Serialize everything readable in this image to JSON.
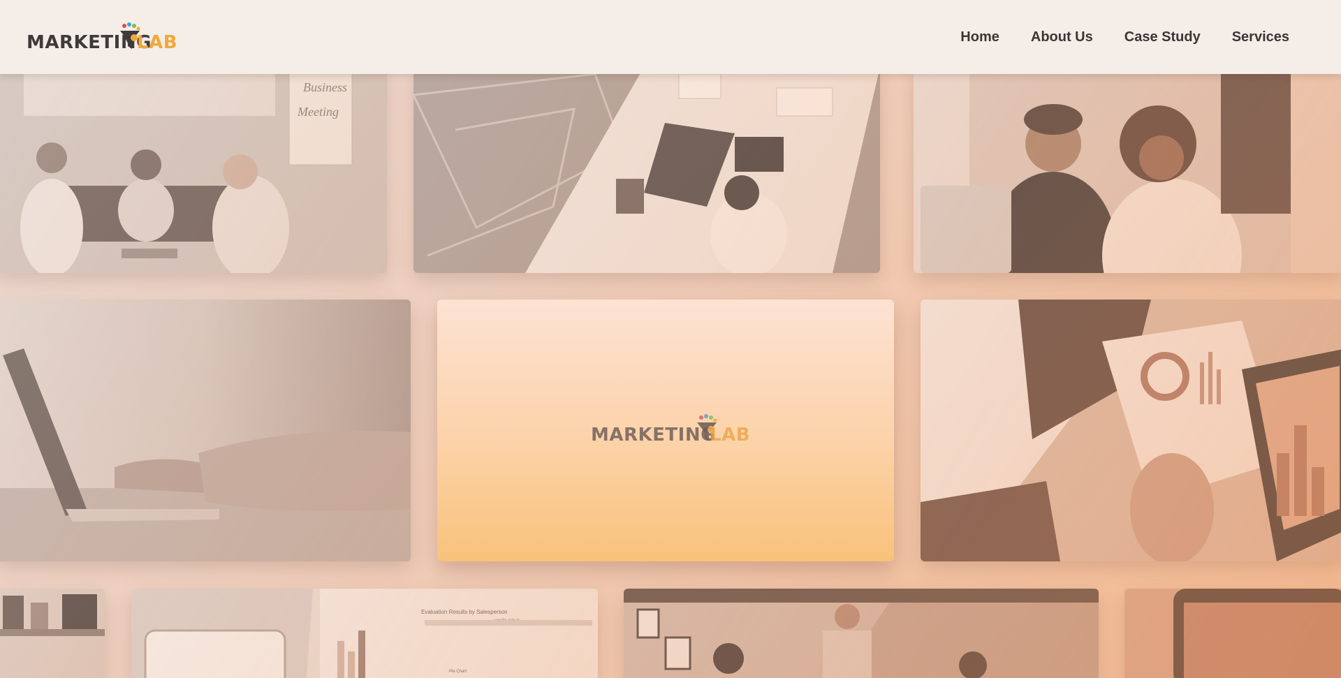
{
  "brand": {
    "logo_word_1": "MARKETING",
    "logo_word_2": "LAB",
    "logo_dark": "#3f3a3a",
    "logo_accent": "#f0a93b"
  },
  "nav": {
    "items": [
      {
        "label": "Home"
      },
      {
        "label": "About Us"
      },
      {
        "label": "Case Study"
      },
      {
        "label": "Services"
      }
    ]
  },
  "gallery": {
    "center_card_logo_word_1": "MARKETING",
    "center_card_logo_word_2": "LAB",
    "photo_text": {
      "whiteboard_line_1": "Business",
      "whiteboard_line_2": "Meeting",
      "doc_title": "Evaluation Results by Salesperson",
      "doc_col_header": "UNITS SOLD",
      "doc_chart_label": "Pie Chart"
    }
  },
  "theme": {
    "header_bg": "#f4ede8",
    "card_gradient_top": "#fde2d3",
    "card_gradient_bottom": "#f8c27a"
  }
}
